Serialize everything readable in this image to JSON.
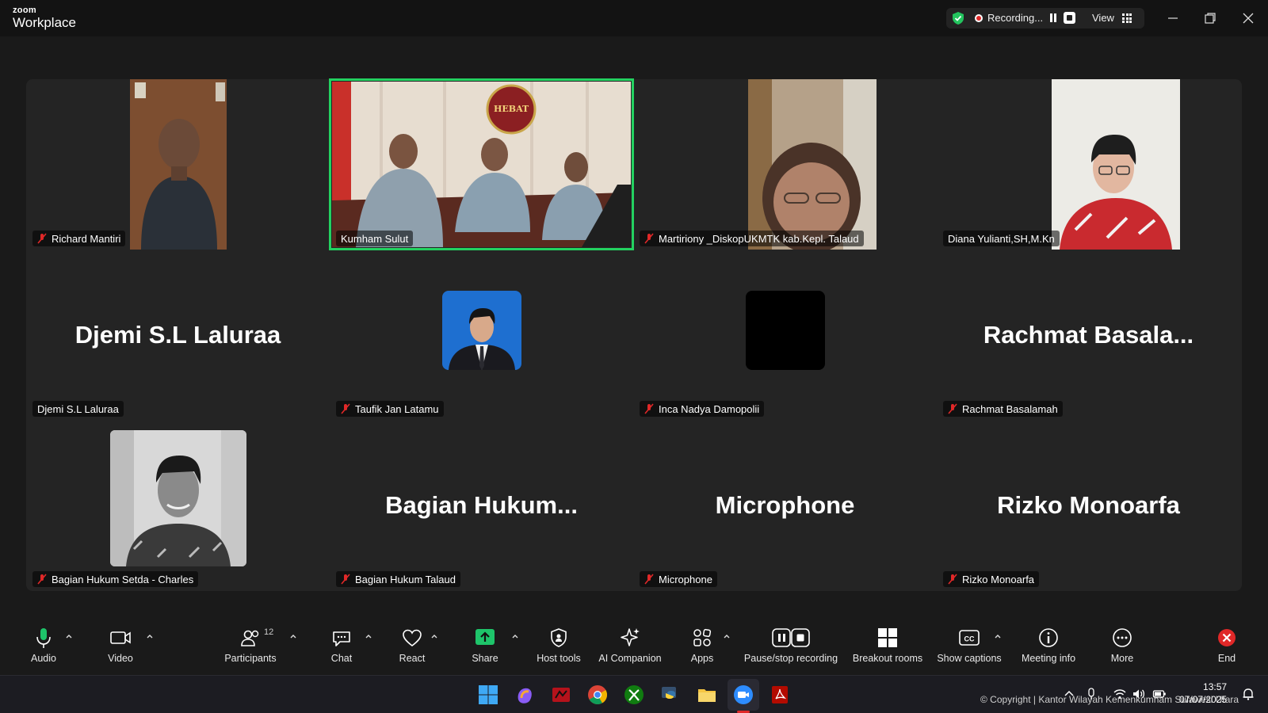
{
  "app": {
    "brand_small": "zoom",
    "brand_big": "Workplace"
  },
  "recording": {
    "label": "Recording...",
    "view_label": "View"
  },
  "tiles": [
    {
      "name": "Richard Mantiri",
      "muted": true
    },
    {
      "name": "Kumham Sulut",
      "muted": false,
      "active": true
    },
    {
      "name": "Martiriony _DiskopUKMTK kab.Kepl. Talaud",
      "muted": true
    },
    {
      "name": "Diana Yulianti,SH,M.Kn",
      "muted": false
    },
    {
      "name": "Djemi S.L Laluraa",
      "muted": false,
      "display": "Djemi S.L Laluraa"
    },
    {
      "name": "Taufik Jan Latamu",
      "muted": true
    },
    {
      "name": "Inca Nadya Damopolii",
      "muted": true
    },
    {
      "name": "Rachmat Basalamah",
      "muted": true,
      "display": "Rachmat  Basala..."
    },
    {
      "name": "Bagian Hukum Setda - Charles",
      "muted": true
    },
    {
      "name": "Bagian Hukum Talaud",
      "muted": true,
      "display": "Bagian  Hukum..."
    },
    {
      "name": "Microphone",
      "muted": true,
      "display": "Microphone"
    },
    {
      "name": "Rizko Monoarfa",
      "muted": true,
      "display": "Rizko Monoarfa"
    }
  ],
  "hebat_sign": "HEBAT",
  "toolbar": {
    "audio": "Audio",
    "video": "Video",
    "participants": "Participants",
    "participants_count": "12",
    "chat": "Chat",
    "react": "React",
    "share": "Share",
    "host_tools": "Host tools",
    "ai_companion": "AI Companion",
    "apps": "Apps",
    "pause_stop": "Pause/stop recording",
    "breakout": "Breakout rooms",
    "captions": "Show captions",
    "meeting_info": "Meeting info",
    "more": "More",
    "end": "End"
  },
  "taskbar": {
    "copyright": "© Copyright | Kantor Wilayah Kemenkumham Sulawesi Utara",
    "time": "13:57",
    "date": "07/07/2025"
  },
  "colors": {
    "accent_green": "#23d160",
    "share_green": "#1ec46a",
    "end_red": "#e02828",
    "rec_red": "#e02828"
  }
}
